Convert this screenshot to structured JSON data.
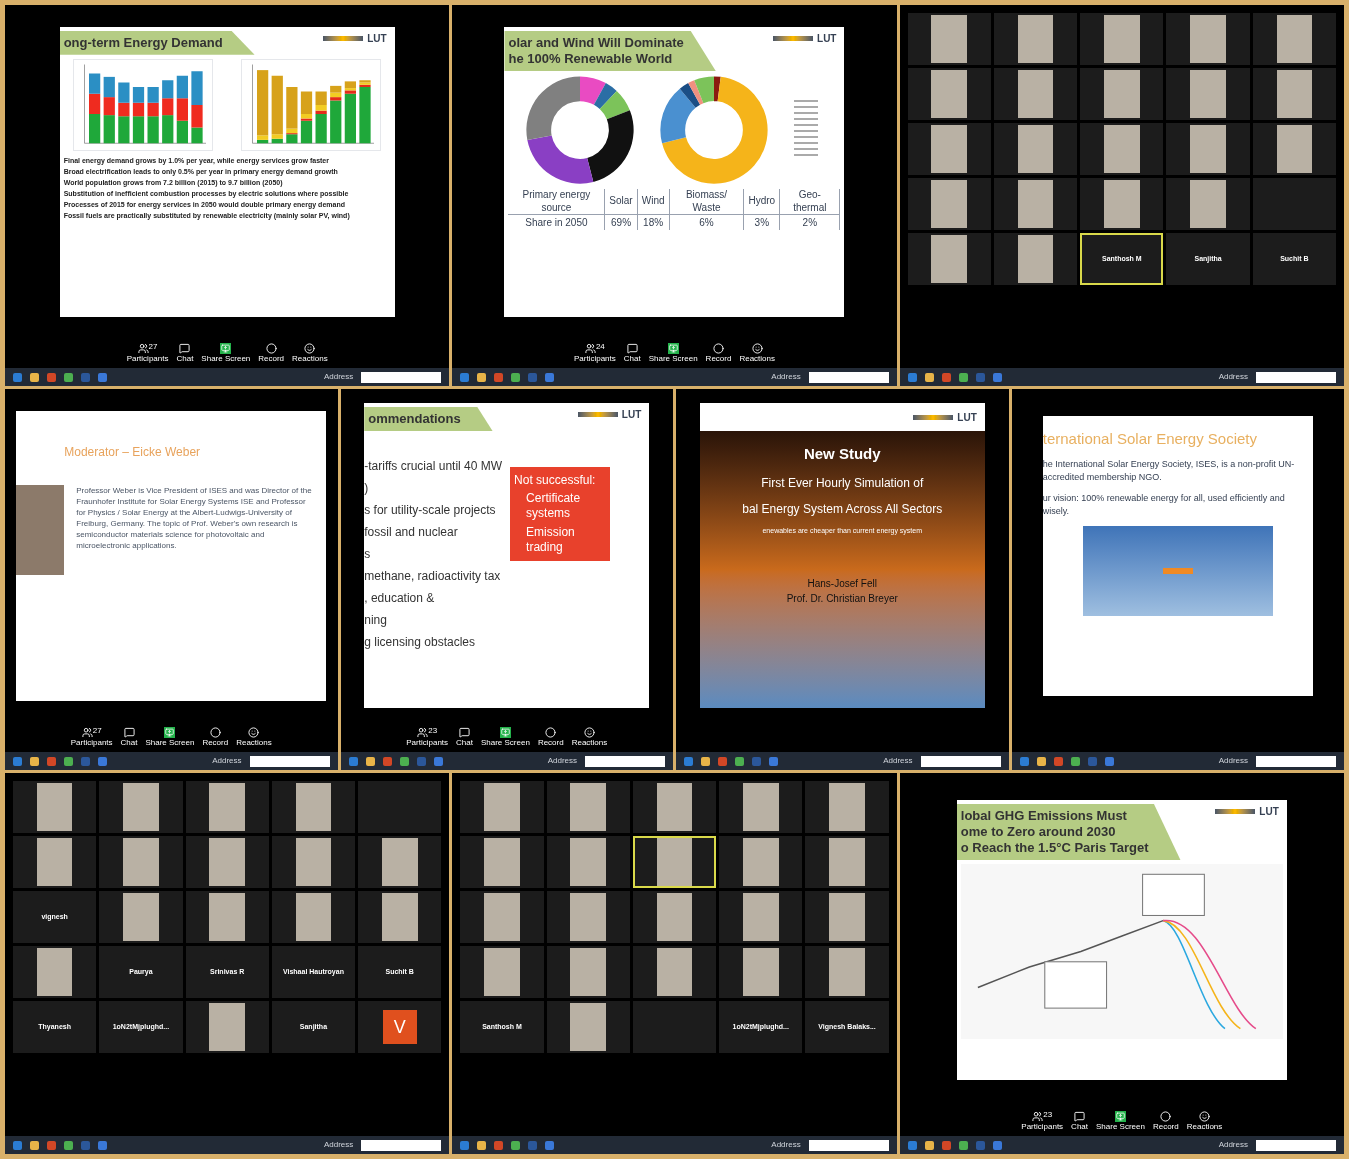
{
  "rows": [
    {
      "panels": [
        {
          "kind": "slide",
          "slide": {
            "kind": "chart-text",
            "title": "ong-term Energy Demand",
            "logo": "LUT",
            "bullets": [
              "Final energy demand grows by 1.0% per year, while energy services grow faster",
              "Broad electrification leads to only 0.5% per year in primary energy demand growth",
              "World population grows from 7.2 billion (2015) to 9.7 billion (2050)",
              "Substitution of inefficient combustion processes by electric solutions where possible",
              "Processes of 2015 for energy services in 2050 would double primary energy demand",
              "Fossil fuels are practically substituted by renewable electricity (mainly solar PV, wind)"
            ]
          },
          "toolbar": {
            "count": "27",
            "labels": [
              "Participants",
              "Chat",
              "Share Screen",
              "Record",
              "Reactions"
            ]
          },
          "taskbar": {
            "address": "Address"
          }
        },
        {
          "kind": "slide",
          "slide": {
            "kind": "donut-table",
            "title": [
              "olar and Wind Will Dominate",
              "he 100% Renewable World"
            ],
            "logo": "LUT",
            "table": {
              "header": [
                "Primary energy source",
                "Solar",
                "Wind",
                "Biomass/ Waste",
                "Hydro",
                "Geo-thermal"
              ],
              "row": [
                "Share in 2050",
                "69%",
                "18%",
                "6%",
                "3%",
                "2%"
              ]
            }
          },
          "toolbar": {
            "count": "24",
            "labels": [
              "Participants",
              "Chat",
              "Share Screen",
              "Record",
              "Reactions"
            ]
          },
          "taskbar": {
            "address": "Address"
          }
        },
        {
          "kind": "gallery",
          "tiles": [
            {
              "kind": "video",
              "speaking": false
            },
            {
              "kind": "video",
              "speaking": false
            },
            {
              "kind": "video",
              "speaking": false
            },
            {
              "kind": "video",
              "speaking": false
            },
            {
              "kind": "video",
              "speaking": false
            },
            {
              "kind": "video",
              "speaking": false
            },
            {
              "kind": "video",
              "speaking": false
            },
            {
              "kind": "video",
              "speaking": false
            },
            {
              "kind": "video",
              "speaking": false
            },
            {
              "kind": "video",
              "speaking": false
            },
            {
              "kind": "video",
              "speaking": false
            },
            {
              "kind": "video",
              "speaking": false
            },
            {
              "kind": "video",
              "speaking": false
            },
            {
              "kind": "video",
              "speaking": false
            },
            {
              "kind": "video",
              "speaking": false
            },
            {
              "kind": "video",
              "speaking": false
            },
            {
              "kind": "video",
              "speaking": false
            },
            {
              "kind": "video",
              "speaking": false
            },
            {
              "kind": "video",
              "speaking": false
            },
            {
              "kind": "blank",
              "speaking": false
            },
            {
              "kind": "video",
              "speaking": false
            },
            {
              "kind": "video",
              "speaking": false
            },
            {
              "kind": "name",
              "name": "Santhosh M",
              "speaking": true
            },
            {
              "kind": "name",
              "name": "Sanjitha",
              "speaking": false
            },
            {
              "kind": "name",
              "name": "Suchit B",
              "speaking": false
            }
          ],
          "taskbar": {
            "address": "Address"
          }
        }
      ]
    },
    {
      "panels": [
        {
          "kind": "slide",
          "slide": {
            "kind": "moderator",
            "title": "Moderator – Eicke Weber",
            "text": "Professor Weber is Vice President of ISES and was Director of the Fraunhofer Institute for Solar Energy Systems ISE and Professor for Physics / Solar Energy at the Albert-Ludwigs-University of Freiburg, Germany. The topic of Prof. Weber's own research is semiconductor materials science for photovoltaic and microelectronic applications."
          },
          "toolbar": {
            "count": "27",
            "labels": [
              "Participants",
              "Chat",
              "Share Screen",
              "Record",
              "Reactions"
            ]
          },
          "taskbar": {
            "address": "Address"
          }
        },
        {
          "kind": "slide",
          "slide": {
            "kind": "recommendations",
            "title": "ommendations",
            "logo": "LUT",
            "lines": [
              "-tariffs crucial until 40 MW",
              ")",
              "s for utility-scale projects",
              "fossil and nuclear",
              "s",
              "methane, radioactivity tax",
              ", education &",
              "ning",
              "g licensing obstacles"
            ],
            "box": {
              "heading": "Not successful:",
              "items": [
                "Certificate systems",
                "Emission trading"
              ]
            }
          },
          "toolbar": {
            "count": "23",
            "labels": [
              "Participants",
              "Chat",
              "Share Screen",
              "Record",
              "Reactions"
            ]
          },
          "taskbar": {
            "address": "Address"
          }
        },
        {
          "kind": "slide",
          "slide": {
            "kind": "photo-title",
            "logo": "LUT",
            "heading": "New Study",
            "lines": [
              "First Ever Hourly Simulation of",
              "bal Energy System Across All Sectors"
            ],
            "sub": "enewables are cheaper than current energy system",
            "authors": [
              "Hans-Josef Fell",
              "Prof. Dr. Christian Breyer"
            ]
          },
          "taskbar": {
            "address": "Address"
          }
        },
        {
          "kind": "slide",
          "slide": {
            "kind": "website",
            "title": "ternational Solar Energy Society",
            "paragraphs": [
              "he International Solar Energy Society, ISES, is a non-profit UN-accredited membership NGO.",
              "ur vision: 100% renewable energy for all, used efficiently and wisely."
            ]
          },
          "taskbar": {
            "address": "Address"
          }
        }
      ]
    },
    {
      "panels": [
        {
          "kind": "gallery",
          "tiles": [
            {
              "kind": "video",
              "speaking": false
            },
            {
              "kind": "video",
              "speaking": false
            },
            {
              "kind": "video",
              "speaking": false
            },
            {
              "kind": "video",
              "speaking": false
            },
            {
              "kind": "blank",
              "speaking": false
            },
            {
              "kind": "video",
              "speaking": false
            },
            {
              "kind": "video",
              "speaking": false
            },
            {
              "kind": "video",
              "speaking": false
            },
            {
              "kind": "video",
              "speaking": false
            },
            {
              "kind": "video",
              "speaking": false
            },
            {
              "kind": "name",
              "name": "vignesh",
              "speaking": false
            },
            {
              "kind": "video",
              "speaking": false
            },
            {
              "kind": "video",
              "speaking": false
            },
            {
              "kind": "video",
              "speaking": false
            },
            {
              "kind": "video",
              "speaking": false
            },
            {
              "kind": "video",
              "speaking": false
            },
            {
              "kind": "name",
              "name": "Paurya",
              "speaking": false
            },
            {
              "kind": "name",
              "name": "Srinivas R",
              "speaking": false
            },
            {
              "kind": "name",
              "name": "Vishaal Hautroyan",
              "speaking": false
            },
            {
              "kind": "name",
              "name": "Suchit B",
              "speaking": false
            },
            {
              "kind": "name",
              "name": "Thyanesh",
              "speaking": false
            },
            {
              "kind": "name",
              "name": "1oN2tMjplughd...",
              "speaking": false
            },
            {
              "kind": "video",
              "speaking": false
            },
            {
              "kind": "name",
              "name": "Sanjitha",
              "speaking": false
            },
            {
              "kind": "letter",
              "name": "V",
              "speaking": false
            }
          ],
          "taskbar": {
            "address": "Address"
          }
        },
        {
          "kind": "gallery",
          "tiles": [
            {
              "kind": "video",
              "speaking": false
            },
            {
              "kind": "video",
              "speaking": false
            },
            {
              "kind": "video",
              "speaking": false
            },
            {
              "kind": "video",
              "speaking": false
            },
            {
              "kind": "video",
              "speaking": false
            },
            {
              "kind": "video",
              "speaking": false
            },
            {
              "kind": "video",
              "speaking": false
            },
            {
              "kind": "video",
              "speaking": true
            },
            {
              "kind": "video",
              "speaking": false
            },
            {
              "kind": "video",
              "speaking": false
            },
            {
              "kind": "video",
              "speaking": false
            },
            {
              "kind": "video",
              "speaking": false
            },
            {
              "kind": "video",
              "speaking": false
            },
            {
              "kind": "video",
              "speaking": false
            },
            {
              "kind": "video",
              "speaking": false
            },
            {
              "kind": "video",
              "speaking": false
            },
            {
              "kind": "video",
              "speaking": false
            },
            {
              "kind": "video",
              "speaking": false
            },
            {
              "kind": "video",
              "speaking": false
            },
            {
              "kind": "video",
              "speaking": false
            },
            {
              "kind": "name",
              "name": "Santhosh M",
              "speaking": false
            },
            {
              "kind": "video",
              "speaking": false
            },
            {
              "kind": "blank",
              "speaking": false
            },
            {
              "kind": "name",
              "name": "1oN2tMjplughd...",
              "speaking": false
            },
            {
              "kind": "name",
              "name": "Vignesh Balaks...",
              "speaking": false
            }
          ],
          "taskbar": {
            "address": "Address"
          }
        },
        {
          "kind": "slide",
          "slide": {
            "kind": "line-chart",
            "title": [
              "lobal GHG Emissions Must",
              "ome to Zero around 2030",
              "o Reach the 1.5°C Paris Target"
            ],
            "logo": "LUT"
          },
          "toolbar": {
            "count": "23",
            "labels": [
              "Participants",
              "Chat",
              "Share Screen",
              "Record",
              "Reactions"
            ]
          },
          "taskbar": {
            "address": "Address"
          }
        }
      ]
    }
  ]
}
